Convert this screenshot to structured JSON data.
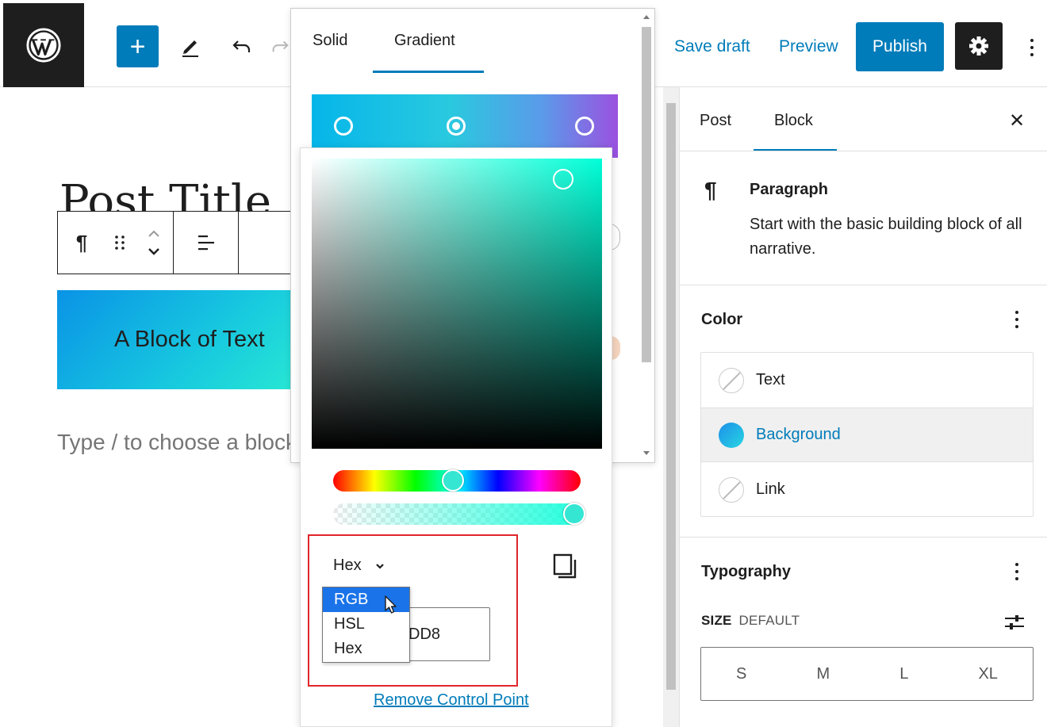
{
  "toolbar": {
    "save_draft": "Save draft",
    "preview": "Preview",
    "publish": "Publish",
    "add_icon": "+"
  },
  "editor": {
    "post_title": "Post Title",
    "block_text": "A Block of Text",
    "placeholder": "Type / to choose a block"
  },
  "gradient_popover": {
    "tabs": [
      "Solid",
      "Gradient"
    ],
    "active_tab": "Gradient"
  },
  "color_picker": {
    "format_label": "Hex",
    "hex_value": "DD8",
    "format_options": [
      "RGB",
      "HSL",
      "Hex"
    ],
    "selected_option": "RGB",
    "remove_link": "Remove Control Point"
  },
  "sidebar": {
    "tabs": [
      "Post",
      "Block"
    ],
    "active_tab": "Block",
    "close_icon": "✕",
    "block_icon": "¶",
    "block_name": "Paragraph",
    "block_description": "Start with the basic building block of all narrative.",
    "color_panel": {
      "title": "Color",
      "items": [
        "Text",
        "Background",
        "Link"
      ],
      "active_item": "Background"
    },
    "typography_panel": {
      "title": "Typography",
      "size_label": "SIZE",
      "size_value": "DEFAULT",
      "sizes": [
        "S",
        "M",
        "L",
        "XL"
      ]
    }
  },
  "colors": {
    "accent": "#007cba",
    "dark": "#1e1e1e",
    "highlight": "#e0262b"
  }
}
